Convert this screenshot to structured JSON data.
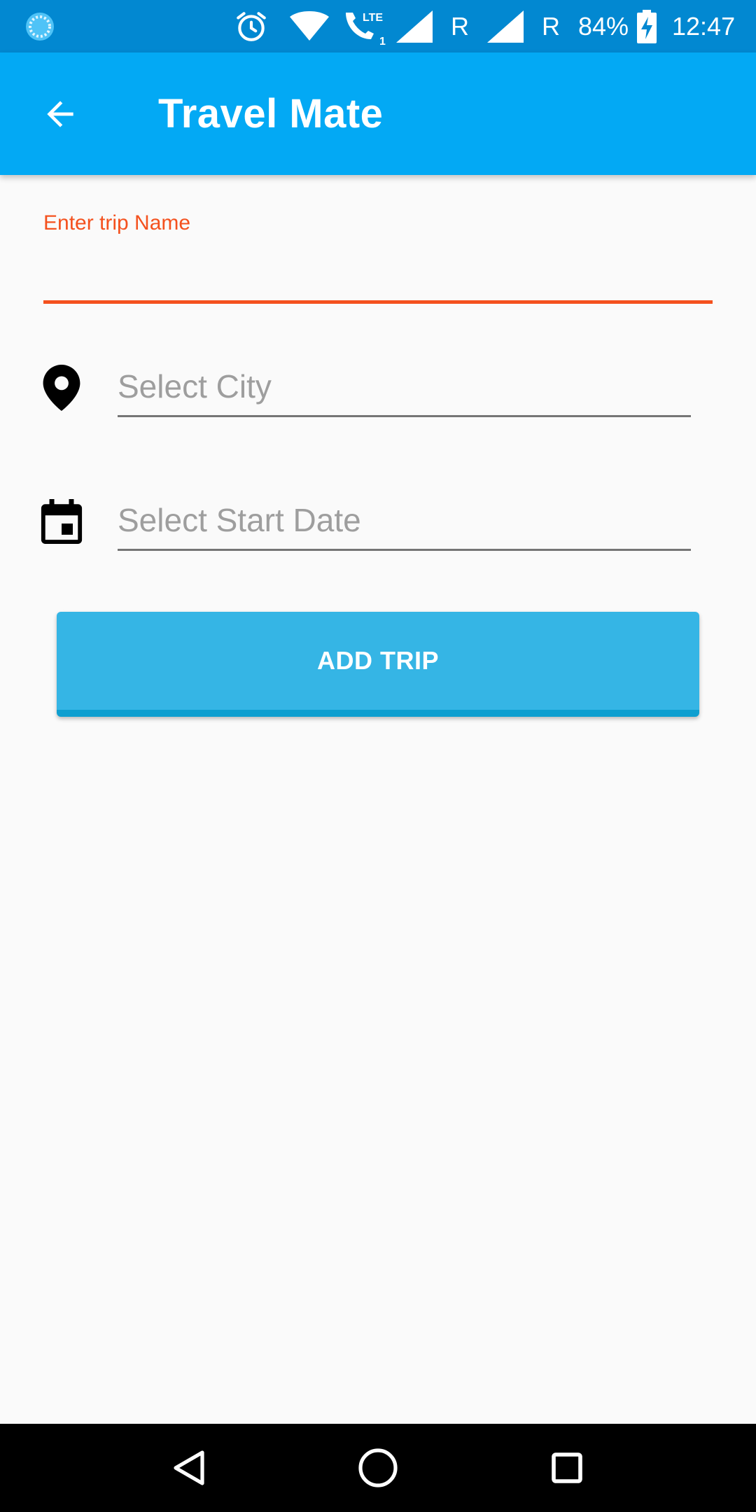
{
  "status_bar": {
    "battery_percent": "84%",
    "time": "12:47",
    "network_letter_1": "R",
    "network_letter_2": "R",
    "lte_label": "LTE",
    "sim_number": "1",
    "icons": [
      "loading-circle-icon",
      "alarm-icon",
      "wifi-icon",
      "lte-call-icon",
      "signal-icon",
      "signal-icon",
      "battery-charging-icon"
    ]
  },
  "app_bar": {
    "title": "Travel Mate",
    "back_icon": "arrow-back-icon"
  },
  "form": {
    "trip_name": {
      "label": "Enter trip Name",
      "value": "",
      "accent_color": "#f4511e"
    },
    "city": {
      "placeholder": "Select City",
      "icon": "location-pin-icon"
    },
    "start_date": {
      "placeholder": "Select Start Date",
      "icon": "calendar-icon"
    },
    "submit_label": "ADD TRIP",
    "submit_color": "#35b5e5"
  },
  "nav_bar": {
    "buttons": [
      "back-triangle-icon",
      "home-circle-icon",
      "recents-square-icon"
    ]
  },
  "colors": {
    "status_bar": "#0288d1",
    "app_bar": "#03a9f4",
    "background": "#fafafa"
  }
}
